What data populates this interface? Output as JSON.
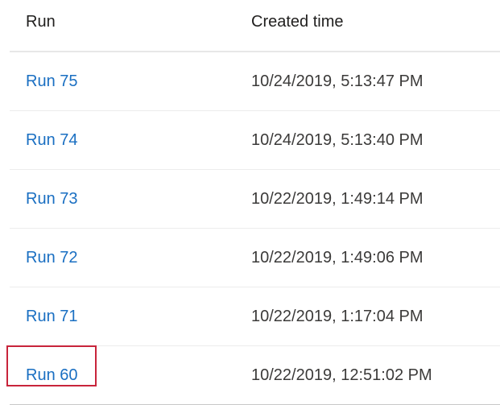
{
  "table": {
    "headers": {
      "run": "Run",
      "created_time": "Created time"
    },
    "rows": [
      {
        "run": "Run 75",
        "created_time": "10/24/2019, 5:13:47 PM"
      },
      {
        "run": "Run 74",
        "created_time": "10/24/2019, 5:13:40 PM"
      },
      {
        "run": "Run 73",
        "created_time": "10/22/2019, 1:49:14 PM"
      },
      {
        "run": "Run 72",
        "created_time": "10/22/2019, 1:49:06 PM"
      },
      {
        "run": "Run 71",
        "created_time": "10/22/2019, 1:17:04 PM"
      },
      {
        "run": "Run 60",
        "created_time": "10/22/2019, 12:51:02 PM"
      }
    ]
  },
  "colors": {
    "link": "#1a6fc2",
    "highlight": "#c8243b",
    "divider": "#ececec"
  }
}
